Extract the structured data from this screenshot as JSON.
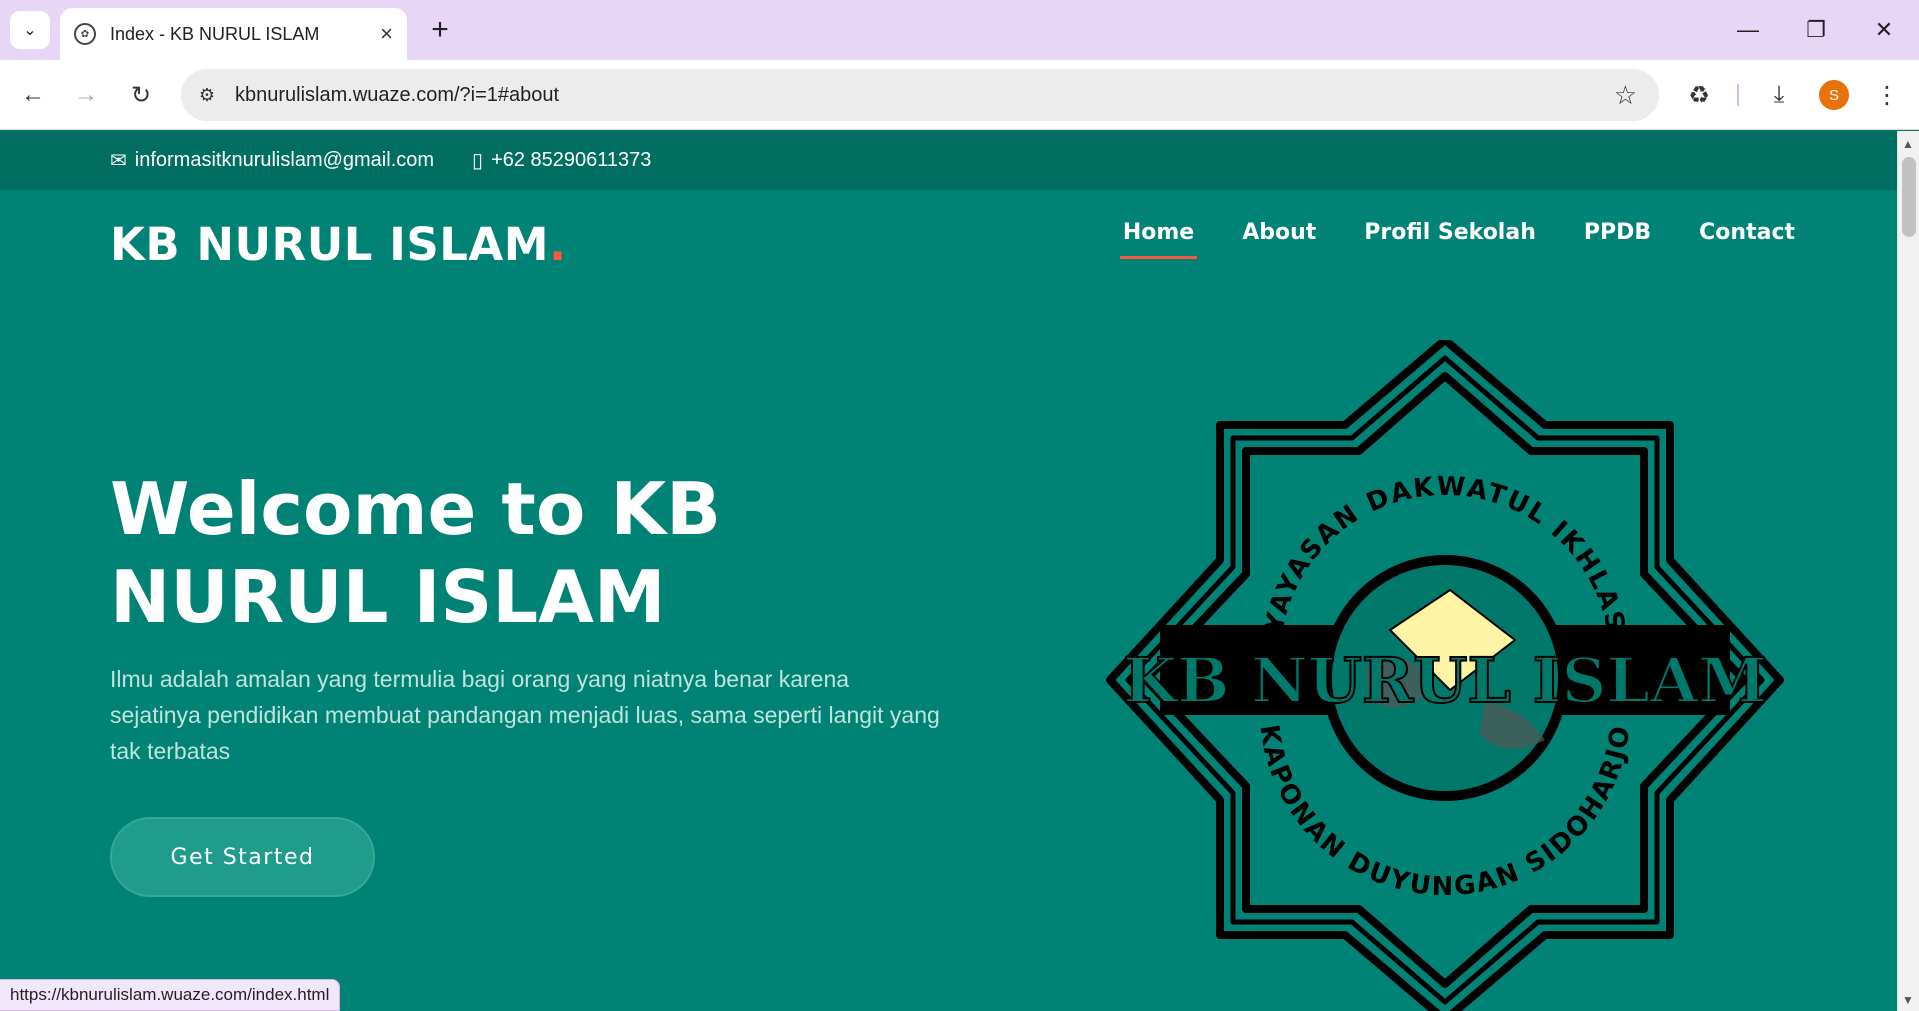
{
  "browser": {
    "tab_title": "Index - KB NURUL ISLAM",
    "url": "kbnurulislam.wuaze.com/?i=1#about",
    "profile_initial": "S",
    "status_url": "https://kbnurulislam.wuaze.com/index.html"
  },
  "topbar": {
    "email": "informasitknurulislam@gmail.com",
    "phone": "+62 85290611373"
  },
  "header": {
    "brand": "KB NURUL ISLAM",
    "brand_dot": ".",
    "nav": {
      "home": "Home",
      "about": "About",
      "profil": "Profil Sekolah",
      "ppdb": "PPDB",
      "contact": "Contact"
    }
  },
  "hero": {
    "title_line1": "Welcome to KB",
    "title_line2": "NURUL ISLAM",
    "text": "Ilmu adalah amalan yang termulia bagi orang yang niatnya benar karena sejatinya pendidikan membuat pandangan menjadi luas, sama seperti langit yang tak terbatas",
    "cta": "Get Started"
  },
  "logo": {
    "arc_top": "YAYASAN DAKWATUL IKHLAS",
    "center": "KB NURUL ISLAM",
    "arc_bottom": "KAPONAN DUYUNGAN SIDOHARJO"
  },
  "colors": {
    "page_bg": "#008374",
    "accent": "#f85a40",
    "tabbar": "#e8d6f7"
  }
}
